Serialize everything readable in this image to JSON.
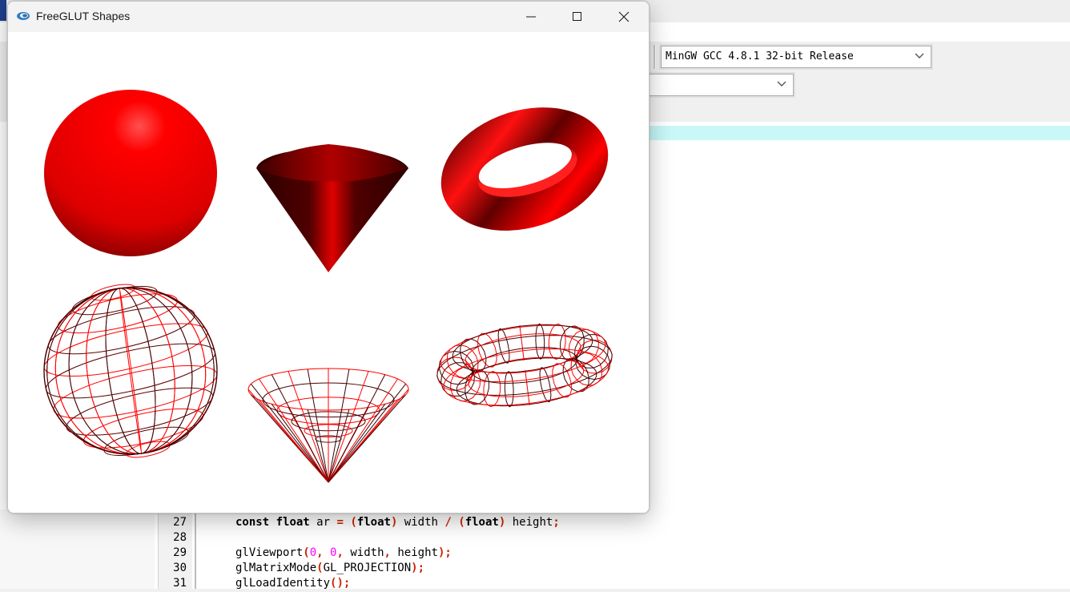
{
  "ide": {
    "compiler_combo": {
      "value": "MinGW GCC 4.8.1 32-bit Release"
    },
    "second_combo": {
      "value": ""
    },
    "code_lines": [
      {
        "num": "27",
        "parts": [
          {
            "t": "const",
            "c": "kw"
          },
          {
            "t": " "
          },
          {
            "t": "float",
            "c": "kw"
          },
          {
            "t": " ar "
          },
          {
            "t": "=",
            "c": "pu"
          },
          {
            "t": " "
          },
          {
            "t": "(",
            "c": "pu"
          },
          {
            "t": "float",
            "c": "kw"
          },
          {
            "t": ")",
            "c": "pu"
          },
          {
            "t": " width "
          },
          {
            "t": "/",
            "c": "pu"
          },
          {
            "t": " "
          },
          {
            "t": "(",
            "c": "pu"
          },
          {
            "t": "float",
            "c": "kw"
          },
          {
            "t": ")",
            "c": "pu"
          },
          {
            "t": " height"
          },
          {
            "t": ";",
            "c": "pu"
          }
        ]
      },
      {
        "num": "28",
        "parts": []
      },
      {
        "num": "29",
        "parts": [
          {
            "t": "glViewport"
          },
          {
            "t": "(",
            "c": "pu"
          },
          {
            "t": "0",
            "c": "num"
          },
          {
            "t": ",",
            "c": "pu"
          },
          {
            "t": " "
          },
          {
            "t": "0",
            "c": "num"
          },
          {
            "t": ",",
            "c": "pu"
          },
          {
            "t": " width"
          },
          {
            "t": ",",
            "c": "pu"
          },
          {
            "t": " height"
          },
          {
            "t": ");",
            "c": "pu"
          }
        ]
      },
      {
        "num": "30",
        "parts": [
          {
            "t": "glMatrixMode"
          },
          {
            "t": "(",
            "c": "pu"
          },
          {
            "t": "GL_PROJECTION"
          },
          {
            "t": ");",
            "c": "pu"
          }
        ]
      },
      {
        "num": "31",
        "parts": [
          {
            "t": "glLoadIdentity"
          },
          {
            "t": "();",
            "c": "pu"
          }
        ]
      }
    ]
  },
  "glut_window": {
    "title": "FreeGLUT Shapes",
    "icon": "opengl-app-icon",
    "buttons": {
      "minimize": "minimize-icon",
      "maximize": "maximize-icon",
      "close": "close-icon"
    },
    "shapes": [
      {
        "name": "solid-sphere",
        "kind": "sphere",
        "style": "solid"
      },
      {
        "name": "solid-cone",
        "kind": "cone",
        "style": "solid"
      },
      {
        "name": "solid-torus",
        "kind": "torus",
        "style": "solid"
      },
      {
        "name": "wire-sphere",
        "kind": "sphere",
        "style": "wire"
      },
      {
        "name": "wire-cone",
        "kind": "cone",
        "style": "wire"
      },
      {
        "name": "wire-torus",
        "kind": "torus",
        "style": "wire"
      }
    ],
    "colors": {
      "shape": "#ff0000",
      "shadow": "#3a0000",
      "background": "#ffffff"
    }
  }
}
